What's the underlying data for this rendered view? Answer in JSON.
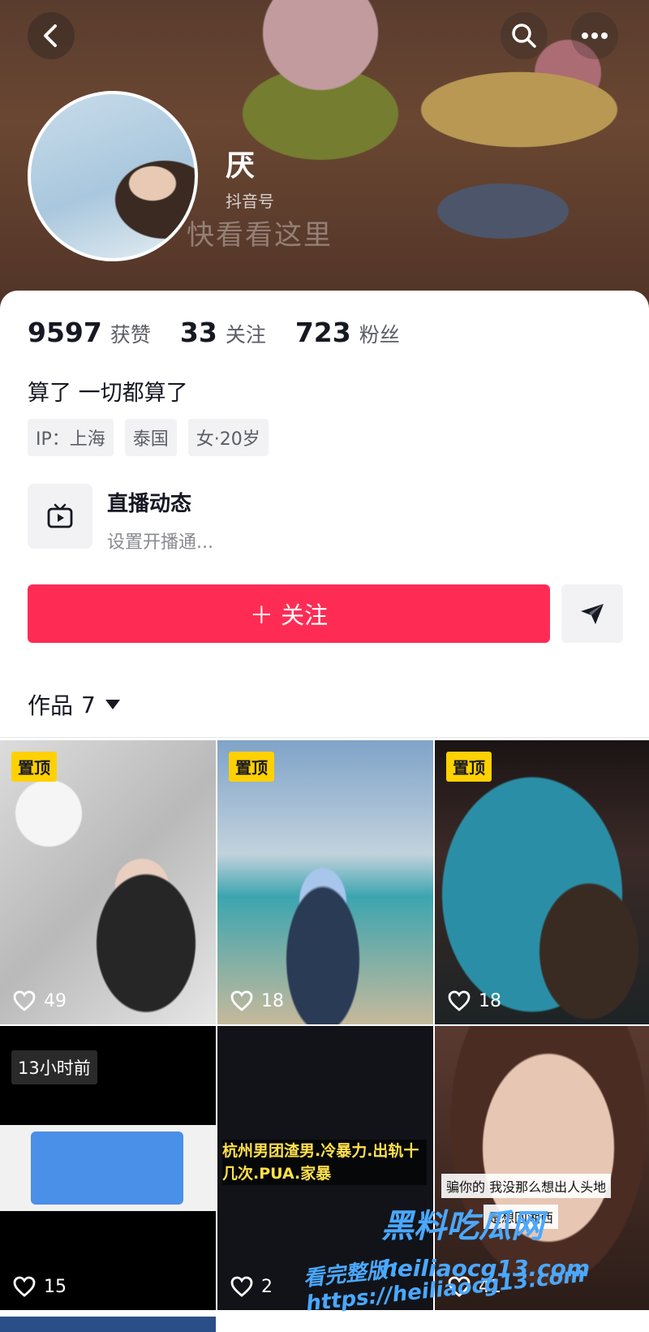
{
  "profile": {
    "name": "厌",
    "douyin_id": "抖音号",
    "banner_watermark": "快看看这里",
    "likes_count": "9597",
    "likes_label": "获赞",
    "following_count": "33",
    "following_label": "关注",
    "followers_count": "723",
    "followers_label": "粉丝",
    "signature": "算了 一切都算了",
    "tags": [
      "IP：上海",
      "泰国",
      "女·20岁"
    ]
  },
  "live": {
    "title": "直播动态",
    "subtitle": "设置开播通..."
  },
  "actions": {
    "follow_label": "＋ 关注"
  },
  "works": {
    "label": "作品",
    "count": "7"
  },
  "grid": {
    "tiles": [
      {
        "pin": "置顶",
        "likes": "49"
      },
      {
        "pin": "置顶",
        "likes": "18"
      },
      {
        "pin": "置顶",
        "likes": "18"
      },
      {
        "time": "13小时前",
        "likes": "15"
      },
      {
        "caption": "杭州男团渣男.冷暴力.出轨十几次.PUA.家暴",
        "likes": "2"
      },
      {
        "overlay1": "骗你的 我没那么想出人头地",
        "overlay2": "是想回湘西",
        "likes": "41"
      }
    ]
  },
  "watermark": {
    "site": "黑料吃瓜网",
    "url": "heiliaocg13.com",
    "line2": "看完整版：https://heiliaocg13.com"
  },
  "colors": {
    "accent": "#fe2c55",
    "pin_badge": "#ffd100"
  }
}
